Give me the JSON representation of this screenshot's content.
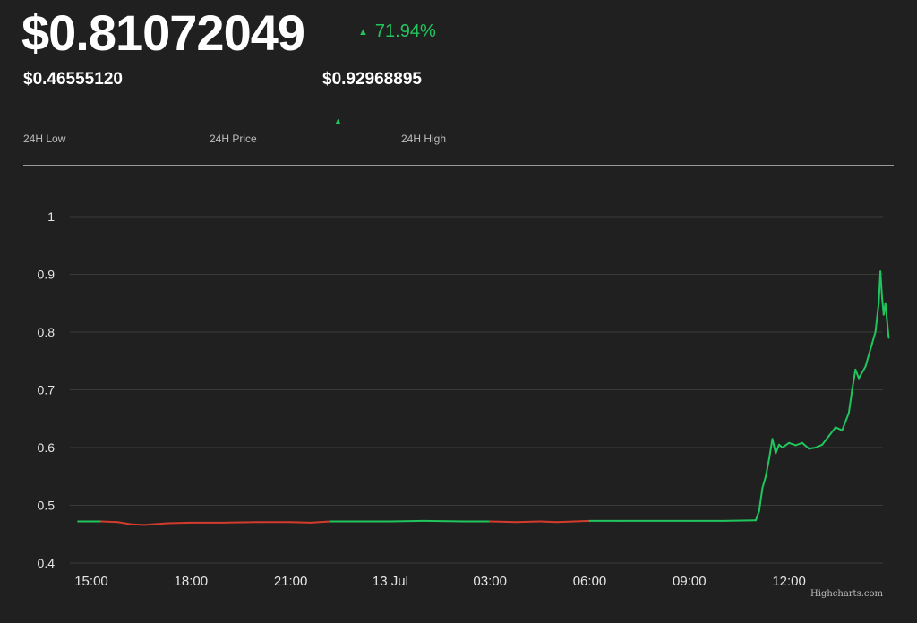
{
  "header": {
    "price": "$0.81072049",
    "change_arrow": "▲",
    "change": "71.94%",
    "low_value": "$0.46555120",
    "high_value": "$0.92968895",
    "marker": "▲",
    "low_caption": "24H Low",
    "price_caption": "24H Price",
    "high_caption": "24H High",
    "up_color": "#21c55d",
    "down_color": "#d33b2c"
  },
  "credit": "Highcharts.com",
  "chart_data": {
    "type": "line",
    "title": "",
    "xlabel": "",
    "ylabel": "",
    "x_ticks": [
      "15:00",
      "18:00",
      "21:00",
      "13 Jul",
      "03:00",
      "06:00",
      "09:00",
      "12:00"
    ],
    "x_tick_hours": [
      0,
      3,
      6,
      9,
      12,
      15,
      18,
      21
    ],
    "y_ticks": [
      "0.4",
      "0.5",
      "0.6",
      "0.7",
      "0.8",
      "0.9",
      "1"
    ],
    "ylim": [
      0.4,
      1.0
    ],
    "xlim_hours": [
      -0.4,
      24.0
    ],
    "grid": true,
    "series": [
      {
        "points": [
          [
            -0.4,
            0.472
          ],
          [
            0.3,
            0.472
          ],
          [
            0.8,
            0.471
          ],
          [
            1.2,
            0.467
          ],
          [
            1.6,
            0.466
          ],
          [
            2.3,
            0.469
          ],
          [
            3.0,
            0.47
          ],
          [
            4.0,
            0.47
          ],
          [
            5.0,
            0.471
          ],
          [
            6.0,
            0.471
          ],
          [
            6.6,
            0.47
          ],
          [
            7.2,
            0.472
          ],
          [
            8.0,
            0.472
          ],
          [
            9.0,
            0.472
          ],
          [
            10.0,
            0.473
          ],
          [
            11.2,
            0.472
          ],
          [
            12.0,
            0.472
          ],
          [
            12.8,
            0.471
          ],
          [
            13.5,
            0.472
          ],
          [
            14.0,
            0.471
          ],
          [
            15.0,
            0.473
          ],
          [
            16.0,
            0.473
          ],
          [
            17.0,
            0.473
          ],
          [
            18.0,
            0.473
          ],
          [
            19.0,
            0.473
          ],
          [
            20.0,
            0.474
          ],
          [
            20.1,
            0.49
          ],
          [
            20.2,
            0.53
          ],
          [
            20.3,
            0.55
          ],
          [
            20.4,
            0.58
          ],
          [
            20.5,
            0.615
          ],
          [
            20.6,
            0.59
          ],
          [
            20.7,
            0.605
          ],
          [
            20.8,
            0.6
          ],
          [
            21.0,
            0.608
          ],
          [
            21.2,
            0.604
          ],
          [
            21.4,
            0.608
          ],
          [
            21.6,
            0.598
          ],
          [
            21.8,
            0.6
          ],
          [
            22.0,
            0.605
          ],
          [
            22.2,
            0.62
          ],
          [
            22.4,
            0.635
          ],
          [
            22.6,
            0.63
          ],
          [
            22.8,
            0.66
          ],
          [
            22.9,
            0.7
          ],
          [
            23.0,
            0.735
          ],
          [
            23.1,
            0.72
          ],
          [
            23.3,
            0.74
          ],
          [
            23.5,
            0.78
          ],
          [
            23.6,
            0.8
          ],
          [
            23.7,
            0.85
          ],
          [
            23.75,
            0.905
          ],
          [
            23.8,
            0.86
          ],
          [
            23.85,
            0.83
          ],
          [
            23.9,
            0.85
          ],
          [
            24.0,
            0.79
          ]
        ]
      }
    ]
  }
}
